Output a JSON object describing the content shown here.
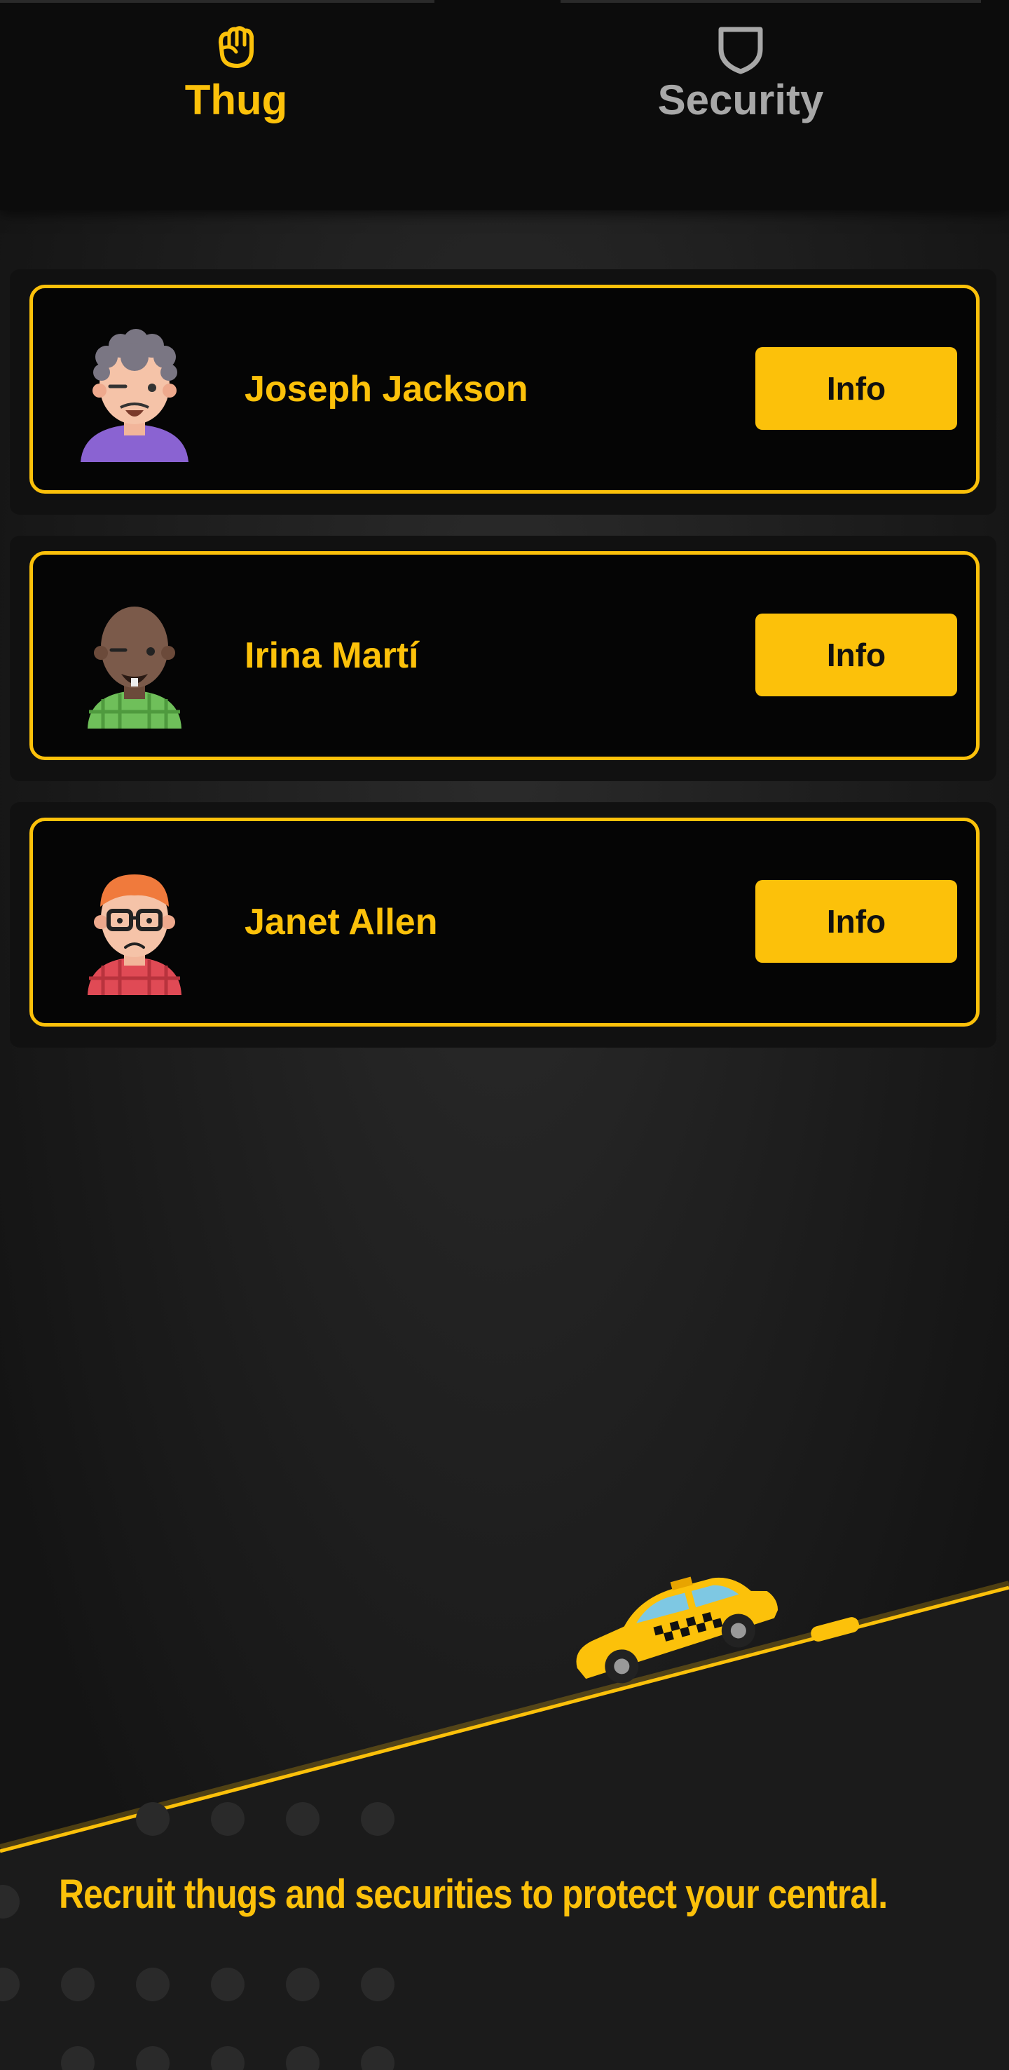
{
  "tabs": [
    {
      "label": "Thug",
      "icon": "fist-icon",
      "active": true
    },
    {
      "label": "Security",
      "icon": "shield-icon",
      "active": false
    }
  ],
  "recruits": [
    {
      "name": "Joseph Jackson",
      "button": "Info",
      "avatar": "avatar-curly-purple-shirt"
    },
    {
      "name": "Irina Martí",
      "button": "Info",
      "avatar": "avatar-bald-green-shirt"
    },
    {
      "name": "Janet Allen",
      "button": "Info",
      "avatar": "avatar-glasses-red-shirt"
    }
  ],
  "footer": {
    "text": "Recruit thugs and securities to protect your central."
  },
  "colors": {
    "accent": "#fcc10a",
    "background": "#141414",
    "card": "#050505",
    "inactive": "#a8a8a8"
  }
}
